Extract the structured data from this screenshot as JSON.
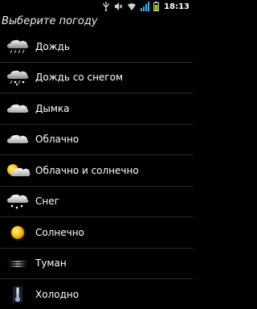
{
  "status_bar": {
    "time": "18:13",
    "icons": [
      "usb-icon",
      "mute-icon",
      "wifi-icon",
      "signal-icon",
      "battery-icon"
    ]
  },
  "title": "Выберите погоду",
  "items": [
    {
      "label": "Дождь",
      "icon": "rain-cloud-icon"
    },
    {
      "label": "Дождь со снегом",
      "icon": "sleet-cloud-icon"
    },
    {
      "label": "Дымка",
      "icon": "haze-cloud-icon"
    },
    {
      "label": "Облачно",
      "icon": "cloud-icon"
    },
    {
      "label": "Облачно и солнечно",
      "icon": "partly-sunny-icon"
    },
    {
      "label": "Снег",
      "icon": "snow-cloud-icon"
    },
    {
      "label": "Солнечно",
      "icon": "sun-icon"
    },
    {
      "label": "Туман",
      "icon": "fog-icon"
    },
    {
      "label": "Холодно",
      "icon": "thermometer-cold-icon"
    }
  ]
}
